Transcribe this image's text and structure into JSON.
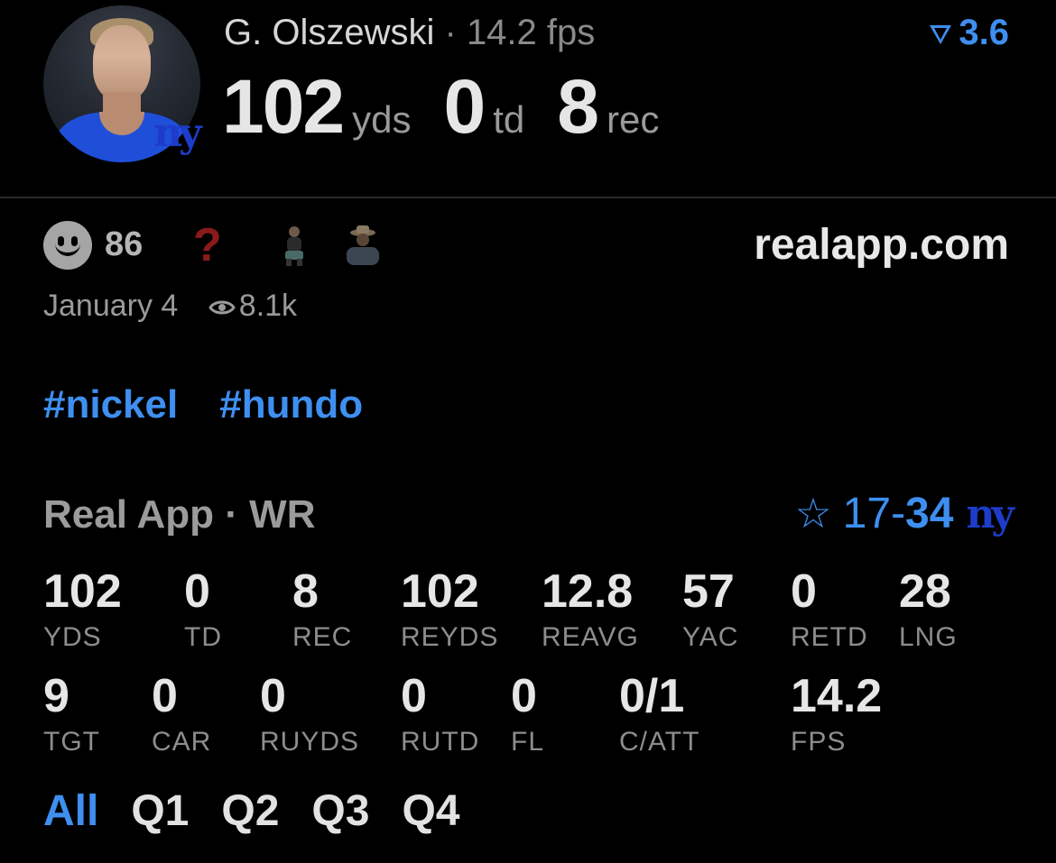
{
  "player": {
    "name": "G. Olszewski",
    "separator": "·",
    "fps": "14.2 fps",
    "rating": "3.6",
    "team_logo": "ny"
  },
  "big_stats": [
    {
      "value": "102",
      "unit": "yds"
    },
    {
      "value": "0",
      "unit": "td"
    },
    {
      "value": "8",
      "unit": "rec"
    }
  ],
  "reactions": {
    "count": "86",
    "question": "?",
    "site": "realapp.com"
  },
  "post": {
    "date": "January 4",
    "views": "8.1k"
  },
  "tags": [
    "#nickel",
    "#hundo"
  ],
  "section": {
    "title": "Real App · WR",
    "score_home": "17",
    "score_dash": "-",
    "score_away": "34",
    "team_logo": "ny"
  },
  "stats_row1": [
    {
      "value": "102",
      "label": "YDS"
    },
    {
      "value": "0",
      "label": "TD"
    },
    {
      "value": "8",
      "label": "REC"
    },
    {
      "value": "102",
      "label": "REYDS"
    },
    {
      "value": "12.8",
      "label": "REAVG"
    },
    {
      "value": "57",
      "label": "YAC"
    },
    {
      "value": "0",
      "label": "RETD"
    },
    {
      "value": "28",
      "label": "LNG"
    }
  ],
  "stats_row2": [
    {
      "value": "9",
      "label": "TGT"
    },
    {
      "value": "0",
      "label": "CAR"
    },
    {
      "value": "0",
      "label": "RUYDS"
    },
    {
      "value": "0",
      "label": "RUTD"
    },
    {
      "value": "0",
      "label": "FL"
    },
    {
      "value": "0/1",
      "label": "C/ATT"
    },
    {
      "value": "14.2",
      "label": "FPS"
    }
  ],
  "quarters": [
    "All",
    "Q1",
    "Q2",
    "Q3",
    "Q4"
  ],
  "colors": {
    "accent": "#3e8ff0",
    "team_blue": "#1d3cc9",
    "background": "#000000"
  }
}
